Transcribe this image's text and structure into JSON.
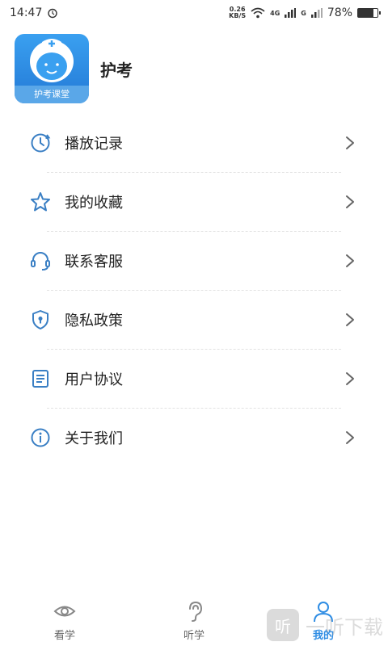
{
  "status": {
    "time": "14:47",
    "netspeed_value": "0.26",
    "netspeed_unit": "KB/S",
    "battery": "78%",
    "battery_fraction": 0.78,
    "signal_label_1": "4G",
    "signal_label_2": "G"
  },
  "profile": {
    "app_name": "护考",
    "logo_text": "护考课堂"
  },
  "menu": {
    "items": [
      {
        "label": "播放记录",
        "icon": "history-clock-icon"
      },
      {
        "label": "我的收藏",
        "icon": "star-icon"
      },
      {
        "label": "联系客服",
        "icon": "headset-icon"
      },
      {
        "label": "隐私政策",
        "icon": "shield-lock-icon"
      },
      {
        "label": "用户协议",
        "icon": "document-list-icon"
      },
      {
        "label": "关于我们",
        "icon": "info-icon"
      }
    ]
  },
  "tabs": [
    {
      "label": "看学",
      "icon": "eye-icon",
      "active": false
    },
    {
      "label": "听学",
      "icon": "ear-icon",
      "active": false
    },
    {
      "label": "我的",
      "icon": "user-icon",
      "active": true
    }
  ],
  "watermark": {
    "logo_glyph": "听",
    "text": "一听下载"
  },
  "colors": {
    "accent": "#2f8de4",
    "icon": "#3a7fc4",
    "text": "#222222",
    "chevron": "#666666"
  }
}
